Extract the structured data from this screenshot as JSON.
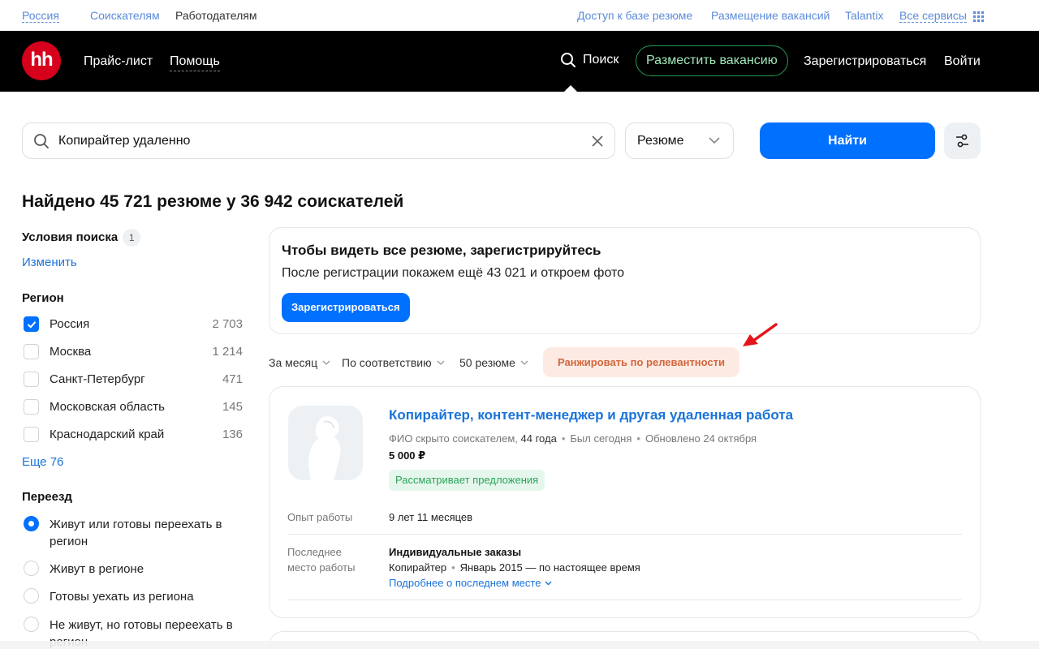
{
  "topbar": {
    "region": "Россия",
    "seekers": "Соискателям",
    "employers": "Работодателям",
    "db_access": "Доступ к базе резюме",
    "vacancy_post": "Размещение вакансий",
    "talantix": "Talantix",
    "all_services": "Все сервисы"
  },
  "header": {
    "logo": "hh",
    "price": "Прайс-лист",
    "help": "Помощь",
    "search": "Поиск",
    "post_vacancy": "Разместить вакансию",
    "register": "Зарегистрироваться",
    "login": "Войти"
  },
  "search": {
    "query": "Копирайтер удаленно",
    "type": "Резюме",
    "find": "Найти"
  },
  "results_title": "Найдено 45 721 резюме у 36 942 соискателей",
  "sidebar": {
    "conditions_label": "Условия поиска",
    "conditions_count": "1",
    "change": "Изменить",
    "region_label": "Регион",
    "regions": [
      {
        "name": "Россия",
        "count": "2 703",
        "checked": true
      },
      {
        "name": "Москва",
        "count": "1 214",
        "checked": false
      },
      {
        "name": "Санкт-Петербург",
        "count": "471",
        "checked": false
      },
      {
        "name": "Московская область",
        "count": "145",
        "checked": false
      },
      {
        "name": "Краснодарский край",
        "count": "136",
        "checked": false
      }
    ],
    "more": "Еще 76",
    "relocation_label": "Переезд",
    "relocation": [
      {
        "label": "Живут или готовы переехать в регион",
        "selected": true
      },
      {
        "label": "Живут в регионе",
        "selected": false
      },
      {
        "label": "Готовы уехать из региона",
        "selected": false
      },
      {
        "label": "Не живут, но готовы переехать в регион",
        "selected": false
      }
    ]
  },
  "reg_card": {
    "title": "Чтобы видеть все резюме, зарегистрируйтесь",
    "desc": "После регистрации покажем ещё 43 021 и откроем фото",
    "button": "Зарегистрироваться"
  },
  "sort": {
    "period": "За месяц",
    "order": "По соответствию",
    "per_page": "50 резюме",
    "rank": "Ранжировать по релевантности"
  },
  "resume": {
    "title": "Копирайтер, контент-менеджер и другая удаленная работа",
    "hidden_name": "ФИО скрыто соискателем,",
    "age": "44 года",
    "seen": "Был сегодня",
    "updated": "Обновлено 24 октября",
    "salary": "5 000 ₽",
    "status": "Рассматривает предложения",
    "experience_label": "Опыт работы",
    "experience": "9 лет 11 месяцев",
    "last_job_label_1": "Последнее",
    "last_job_label_2": "место работы",
    "last_company": "Индивидуальные заказы",
    "last_position": "Копирайтер",
    "last_period": "Январь 2015 — по настоящее время",
    "more_link": "Подробнее о последнем месте"
  },
  "colors": {
    "brand_red": "#d6001c",
    "primary_blue": "#0070ff",
    "link_blue": "#1a73d9",
    "status_green": "#2aa35a",
    "rank_orange": "#d2663e"
  }
}
